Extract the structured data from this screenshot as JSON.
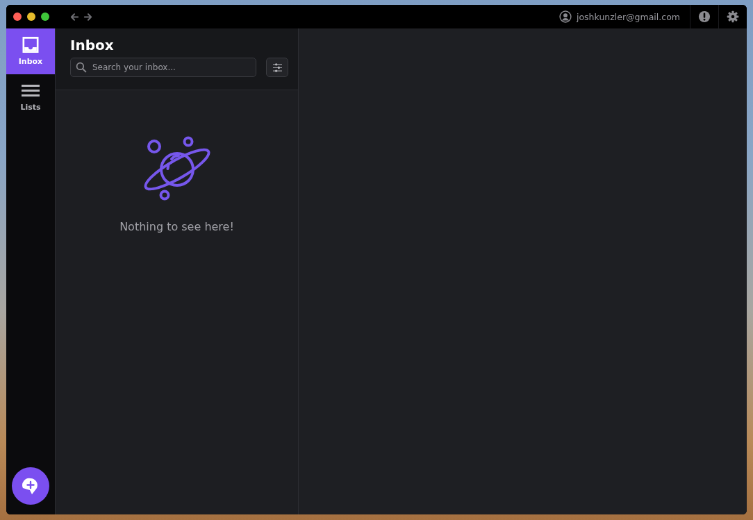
{
  "toolbar": {
    "account_email": "joshkunzler@gmail.com"
  },
  "nav_items": [
    {
      "kind": "inbox",
      "label": "Inbox",
      "selected": true
    },
    {
      "kind": "lists",
      "label": "Lists",
      "selected": false
    }
  ],
  "inbox": {
    "title": "Inbox",
    "search": {
      "placeholder": "Search your inbox..."
    },
    "empty_message": "Nothing to see here!"
  }
}
